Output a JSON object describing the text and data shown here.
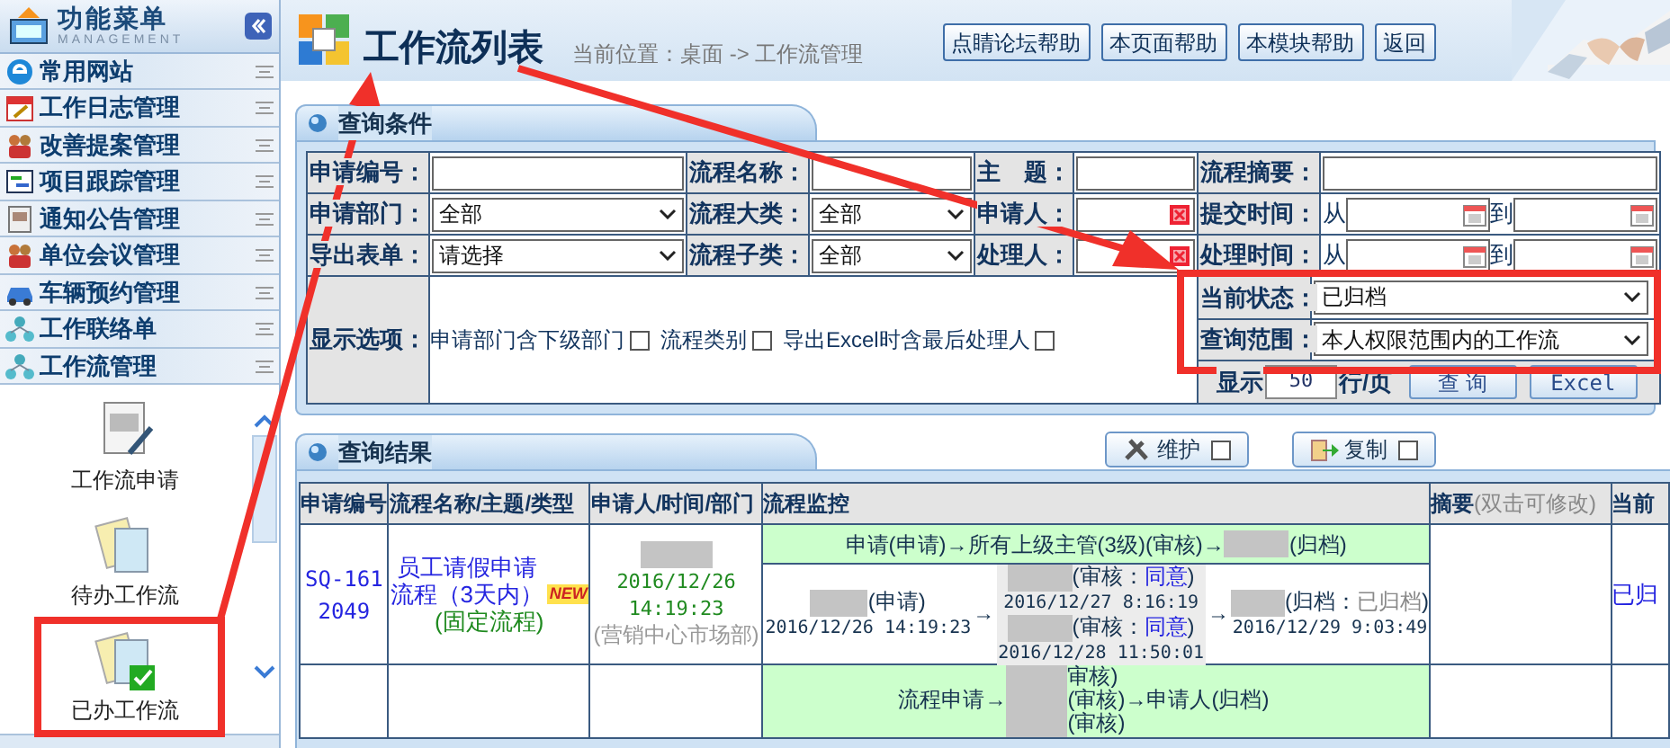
{
  "sidebar": {
    "title": "功能菜单",
    "subtitle": "MANAGEMENT",
    "menu": [
      {
        "label": "常用网站",
        "kind": "web"
      },
      {
        "label": "工作日志管理",
        "kind": "calendar"
      },
      {
        "label": "改善提案管理",
        "kind": "people"
      },
      {
        "label": "项目跟踪管理",
        "kind": "chart"
      },
      {
        "label": "通知公告管理",
        "kind": "notice"
      },
      {
        "label": "单位会议管理",
        "kind": "people"
      },
      {
        "label": "车辆预约管理",
        "kind": "car"
      },
      {
        "label": "工作联络单",
        "kind": "network"
      },
      {
        "label": "工作流管理",
        "kind": "network"
      }
    ],
    "sub_items": [
      {
        "label": "工作流申请",
        "kind": "form"
      },
      {
        "label": "待办工作流",
        "kind": "docs"
      },
      {
        "label": "已办工作流",
        "kind": "done"
      }
    ]
  },
  "header": {
    "title": "工作流列表",
    "breadcrumb": "当前位置：桌面 -> 工作流管理",
    "buttons": [
      "点睛论坛帮助",
      "本页面帮助",
      "本模块帮助",
      "返回"
    ]
  },
  "query": {
    "title": "查询条件",
    "rows": [
      [
        {
          "label": "申请编号：",
          "kind": "text"
        },
        {
          "label": "流程名称：",
          "kind": "text"
        },
        {
          "label": "主　题：",
          "kind": "text"
        },
        {
          "label": "流程摘要：",
          "kind": "text"
        }
      ],
      [
        {
          "label": "申请部门：",
          "kind": "select",
          "value": "全部"
        },
        {
          "label": "流程大类：",
          "kind": "select",
          "value": "全部"
        },
        {
          "label": "申请人：",
          "kind": "picker"
        },
        {
          "label": "提交时间：",
          "kind": "daterange",
          "from": "从",
          "to": "到"
        }
      ],
      [
        {
          "label": "导出表单：",
          "kind": "select",
          "value": "请选择"
        },
        {
          "label": "流程子类：",
          "kind": "select",
          "value": "全部"
        },
        {
          "label": "处理人：",
          "kind": "picker"
        },
        {
          "label": "处理时间：",
          "kind": "daterange",
          "from": "从",
          "to": "到"
        }
      ]
    ],
    "options": {
      "label": "显示选项：",
      "items": [
        {
          "label": "申请部门含下级部门",
          "checked": false
        },
        {
          "label": "流程类别",
          "checked": false
        },
        {
          "label": "导出Excel时含最后处理人",
          "checked": false
        }
      ]
    },
    "status": {
      "label": "当前状态：",
      "value": "已归档"
    },
    "scope": {
      "label": "查询范围：",
      "value": "本人权限范围内的工作流"
    },
    "page_size": {
      "prefix": "显示",
      "value": "50",
      "suffix": "行/页"
    },
    "actions": [
      "查 询",
      "Excel"
    ]
  },
  "results": {
    "title": "查询结果",
    "tools": [
      {
        "label": "维护",
        "kind": "tools",
        "checked": false
      },
      {
        "label": "复制",
        "kind": "copy",
        "checked": false
      }
    ],
    "columns": [
      {
        "label": "申请编号"
      },
      {
        "label": "流程名称/主题/类型"
      },
      {
        "label": "申请人/时间/部门"
      },
      {
        "label": "流程监控"
      },
      {
        "label": "摘要",
        "note": "(双击可修改)"
      },
      {
        "label": "当前"
      }
    ],
    "rows": [
      {
        "id": "SQ-1612049",
        "name": "员工请假申请流程（3天内）",
        "is_new": true,
        "new_badge": "NEW",
        "type": "(固定流程)",
        "time": "2016/12/26 14:19:23",
        "dept": "(营销中心市场部)",
        "flow_line": {
          "before": "申请(申请)→所有上级主管(3级)(审核)→",
          "after": "(归档)"
        },
        "steps": [
          {
            "kind": "single",
            "action": "(申请)",
            "time": "2016/12/26 14:19:23"
          },
          {
            "kind": "group",
            "entries": [
              {
                "action": "(审核：",
                "result": "同意",
                "close": ")",
                "time": "2016/12/27 8:16:19"
              },
              {
                "action": "(审核：",
                "result": "同意",
                "close": ")",
                "time": "2016/12/28 11:50:01"
              }
            ]
          },
          {
            "kind": "archive",
            "action": "(归档：",
            "result": "已归档",
            "close": ")",
            "time": "2016/12/29 9:03:49"
          }
        ],
        "arrow": "→",
        "status": "已归"
      },
      {
        "flow_before": "流程申请→",
        "reviews": [
          "审核)",
          "(审核)",
          "(审核)"
        ],
        "flow_after": "→申请人(归档)"
      }
    ]
  }
}
